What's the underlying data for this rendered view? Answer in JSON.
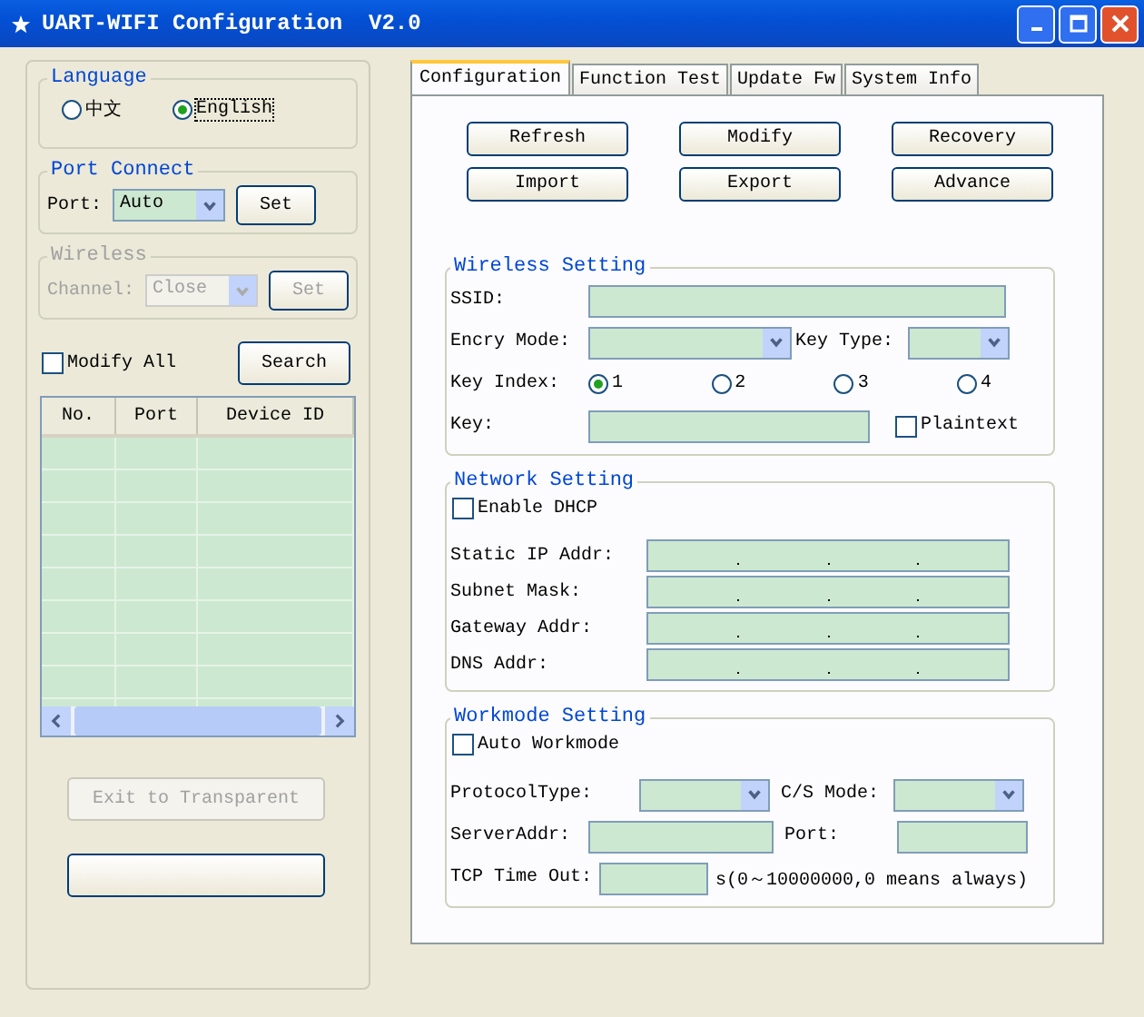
{
  "window": {
    "title": "UART-WIFI Configuration  V2.0"
  },
  "left": {
    "language": {
      "title": "Language",
      "options": [
        {
          "label": "中文",
          "selected": false
        },
        {
          "label": "English",
          "selected": true
        }
      ]
    },
    "port_connect": {
      "title": "Port Connect",
      "port_label": "Port:",
      "port_value": "Auto",
      "set_button": "Set"
    },
    "wireless": {
      "title": "Wireless",
      "channel_label": "Channel:",
      "channel_value": "Close",
      "set_button": "Set",
      "disabled": true
    },
    "modify_all": {
      "label": "Modify All",
      "checked": false
    },
    "search_button": "Search",
    "device_table": {
      "columns": [
        "No.",
        "Port",
        "Device ID"
      ]
    },
    "exit_button": {
      "label": "Exit to Transparent",
      "disabled": true
    }
  },
  "tabs": [
    {
      "label": "Configuration",
      "selected": true
    },
    {
      "label": "Function Test",
      "selected": false
    },
    {
      "label": "Update Fw",
      "selected": false
    },
    {
      "label": "System Info",
      "selected": false
    }
  ],
  "actions": [
    "Refresh",
    "Modify",
    "Recovery",
    "Import",
    "Export",
    "Advance"
  ],
  "wireless_setting": {
    "title": "Wireless Setting",
    "ssid_label": "SSID:",
    "encry_mode_label": "Encry Mode:",
    "key_type_label": "Key Type:",
    "key_index_label": "Key Index:",
    "key_index_options": [
      {
        "label": "1",
        "selected": true
      },
      {
        "label": "2",
        "selected": false
      },
      {
        "label": "3",
        "selected": false
      },
      {
        "label": "4",
        "selected": false
      }
    ],
    "key_label": "Key:",
    "plaintext": {
      "label": "Plaintext",
      "checked": false
    }
  },
  "network_setting": {
    "title": "Network Setting",
    "enable_dhcp": {
      "label": "Enable DHCP",
      "checked": false
    },
    "addresses": [
      {
        "label": "Static IP Addr:"
      },
      {
        "label": "Subnet Mask:"
      },
      {
        "label": "Gateway Addr:"
      },
      {
        "label": "DNS Addr:"
      }
    ]
  },
  "workmode_setting": {
    "title": "Workmode Setting",
    "auto_workmode": {
      "label": "Auto Workmode",
      "checked": false
    },
    "protocol_type_label": "ProtocolType:",
    "cs_mode_label": "C/S Mode:",
    "server_addr_label": "ServerAddr:",
    "port_label": "Port:",
    "tcp_timeout_label": "TCP Time Out:",
    "tcp_timeout_hint": "s(0～10000000,0 means always)"
  }
}
